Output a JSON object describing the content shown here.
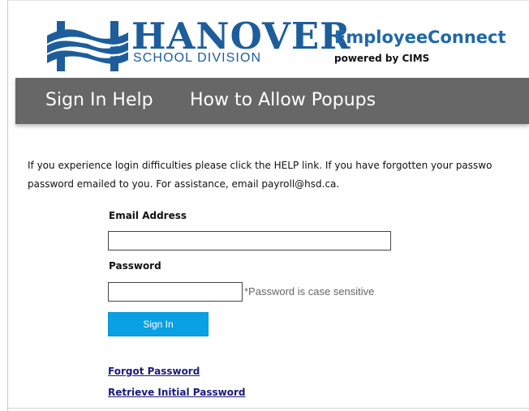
{
  "header": {
    "org_name": "HANOVER",
    "org_subtitle": "SCHOOL DIVISION",
    "app_title": "EmployeeConnect",
    "app_subtitle": "powered by CIMS",
    "logo_icon": "hanover-h-waves-logo",
    "brand_color": "#1d5d9b"
  },
  "nav": {
    "items": [
      {
        "label": "Sign In Help"
      },
      {
        "label": "How to Allow Popups"
      }
    ],
    "background_color": "#676767"
  },
  "info": {
    "lines": [
      "If you experience login difficulties please click the HELP link. If you have forgotten your passwo",
      "password emailed to you. For assistance, email payroll@hsd.ca."
    ]
  },
  "form": {
    "email_label": "Email Address",
    "email_value": "",
    "password_label": "Password",
    "password_value": "",
    "password_hint": "*Password is case sensitive",
    "signin_label": "Sign In",
    "signin_color": "#0aa0e4"
  },
  "links": {
    "forgot_password": "Forgot Password",
    "retrieve_initial_password": "Retrieve Initial Password"
  }
}
